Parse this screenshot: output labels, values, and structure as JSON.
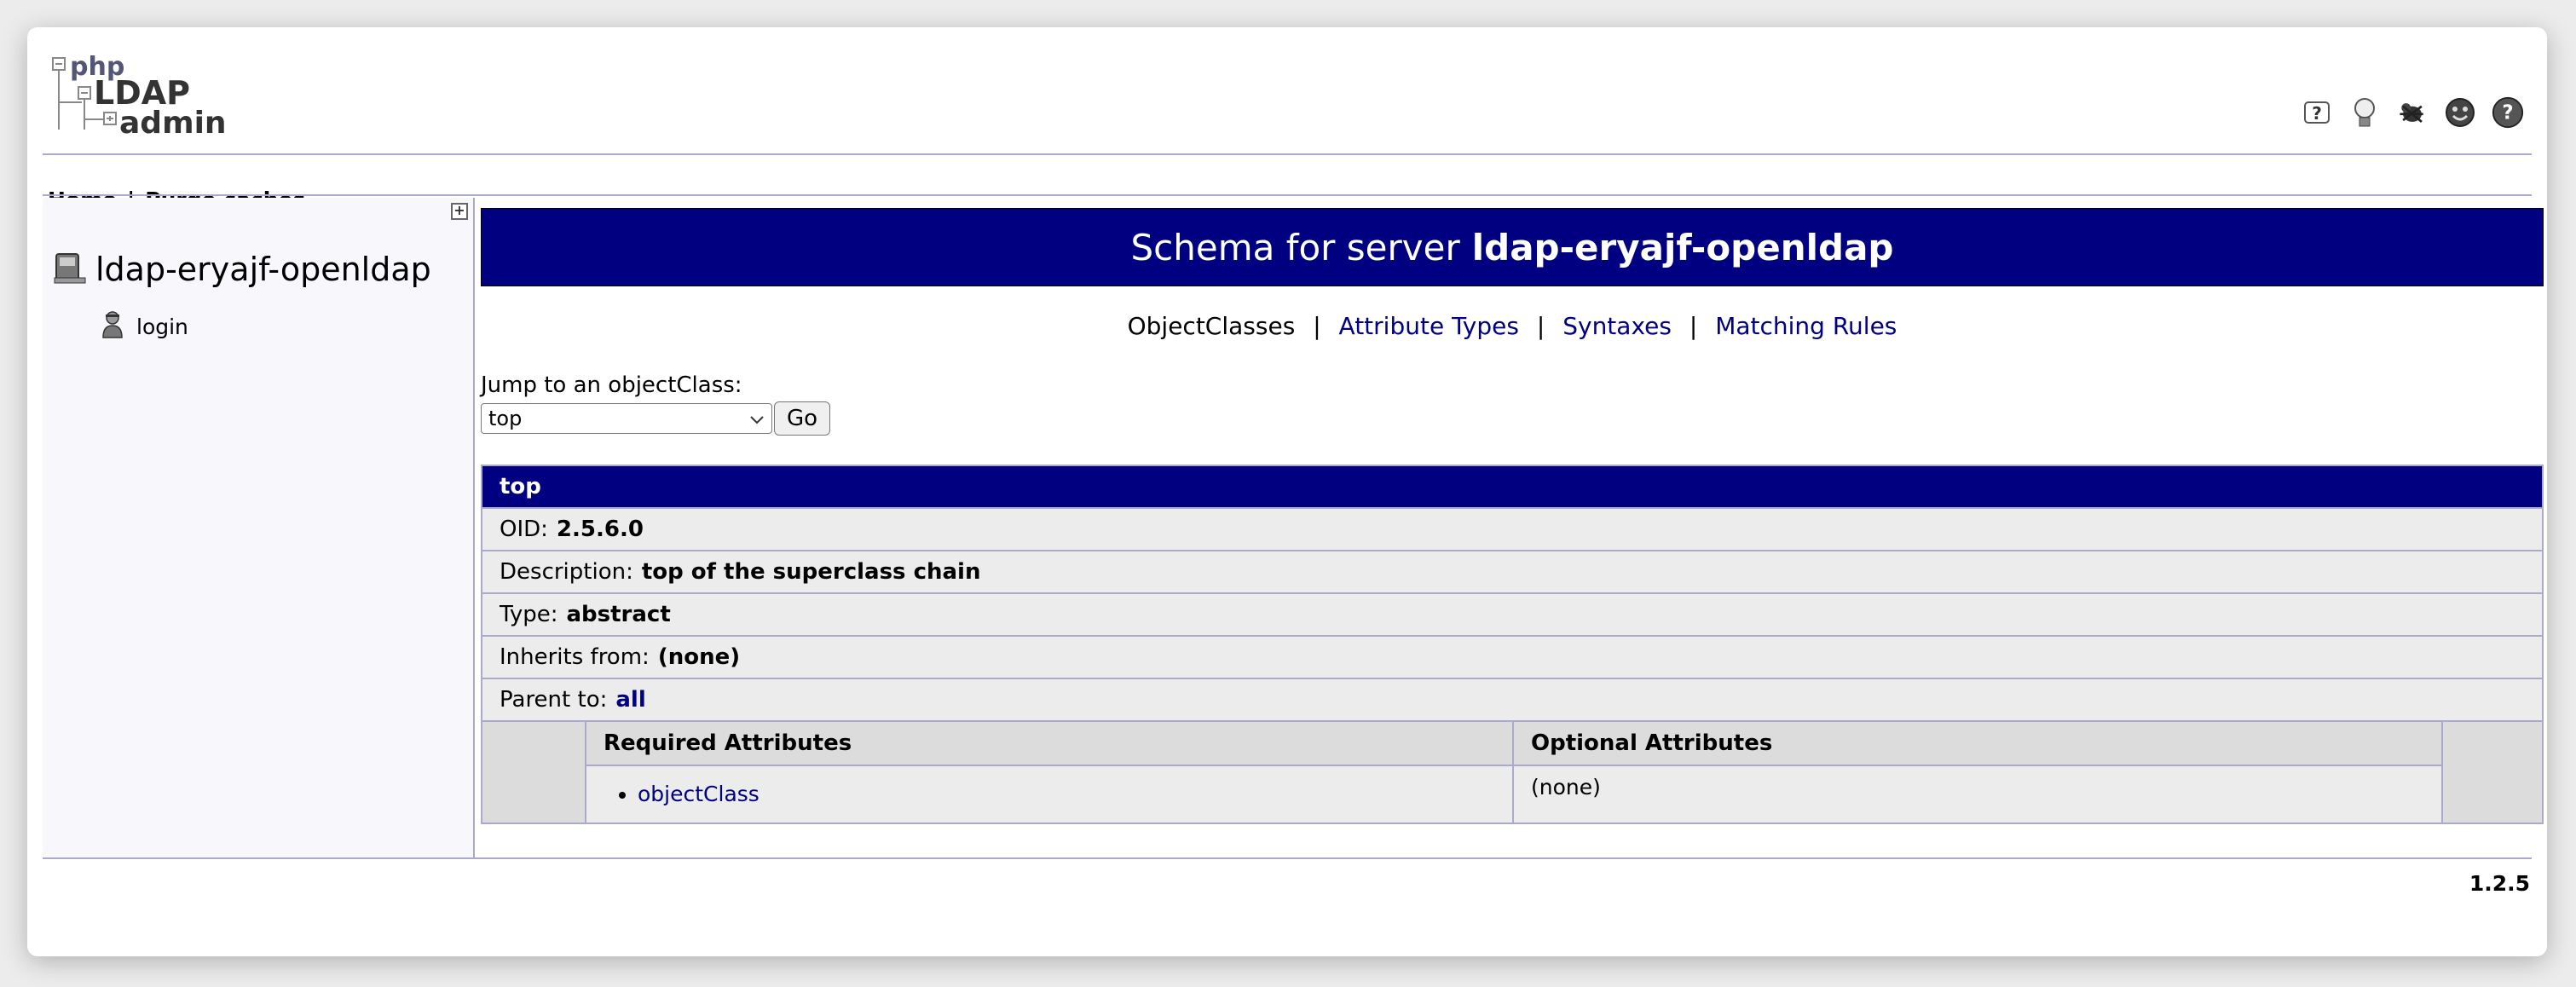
{
  "header": {
    "logo_text": "phpLDAPadmin",
    "icons": [
      "help-icon",
      "lightbulb-icon",
      "bug-icon",
      "donate-icon",
      "about-icon"
    ],
    "menu": {
      "home": "Home",
      "separator": "|",
      "purge": "Purge caches"
    }
  },
  "tree": {
    "expand": "+",
    "server": "ldap-eryajf-openldap",
    "login": "login"
  },
  "main": {
    "title_prefix": "Schema for server",
    "title_server": "ldap-eryajf-openldap",
    "nav": {
      "objectclasses": "ObjectClasses",
      "attribute_types": "Attribute Types",
      "syntaxes": "Syntaxes",
      "matching_rules": "Matching Rules",
      "separator": "|"
    },
    "jump_label": "Jump to an objectClass:",
    "jump_selected": "top",
    "go_label": "Go"
  },
  "objectclass": {
    "name": "top",
    "oid_label": "OID:",
    "oid": "2.5.6.0",
    "description_label": "Description:",
    "description": "top of the superclass chain",
    "type_label": "Type:",
    "type": "abstract",
    "inherits_label": "Inherits from:",
    "inherits": "(none)",
    "parent_label": "Parent to:",
    "parent": "all",
    "required_header": "Required Attributes",
    "optional_header": "Optional Attributes",
    "required": [
      "objectClass"
    ],
    "optional": "(none)"
  },
  "footer": {
    "version": "1.2.5"
  },
  "colors": {
    "navy": "#000080",
    "rule": "#aaaacc",
    "row_bg": "#ececec"
  }
}
